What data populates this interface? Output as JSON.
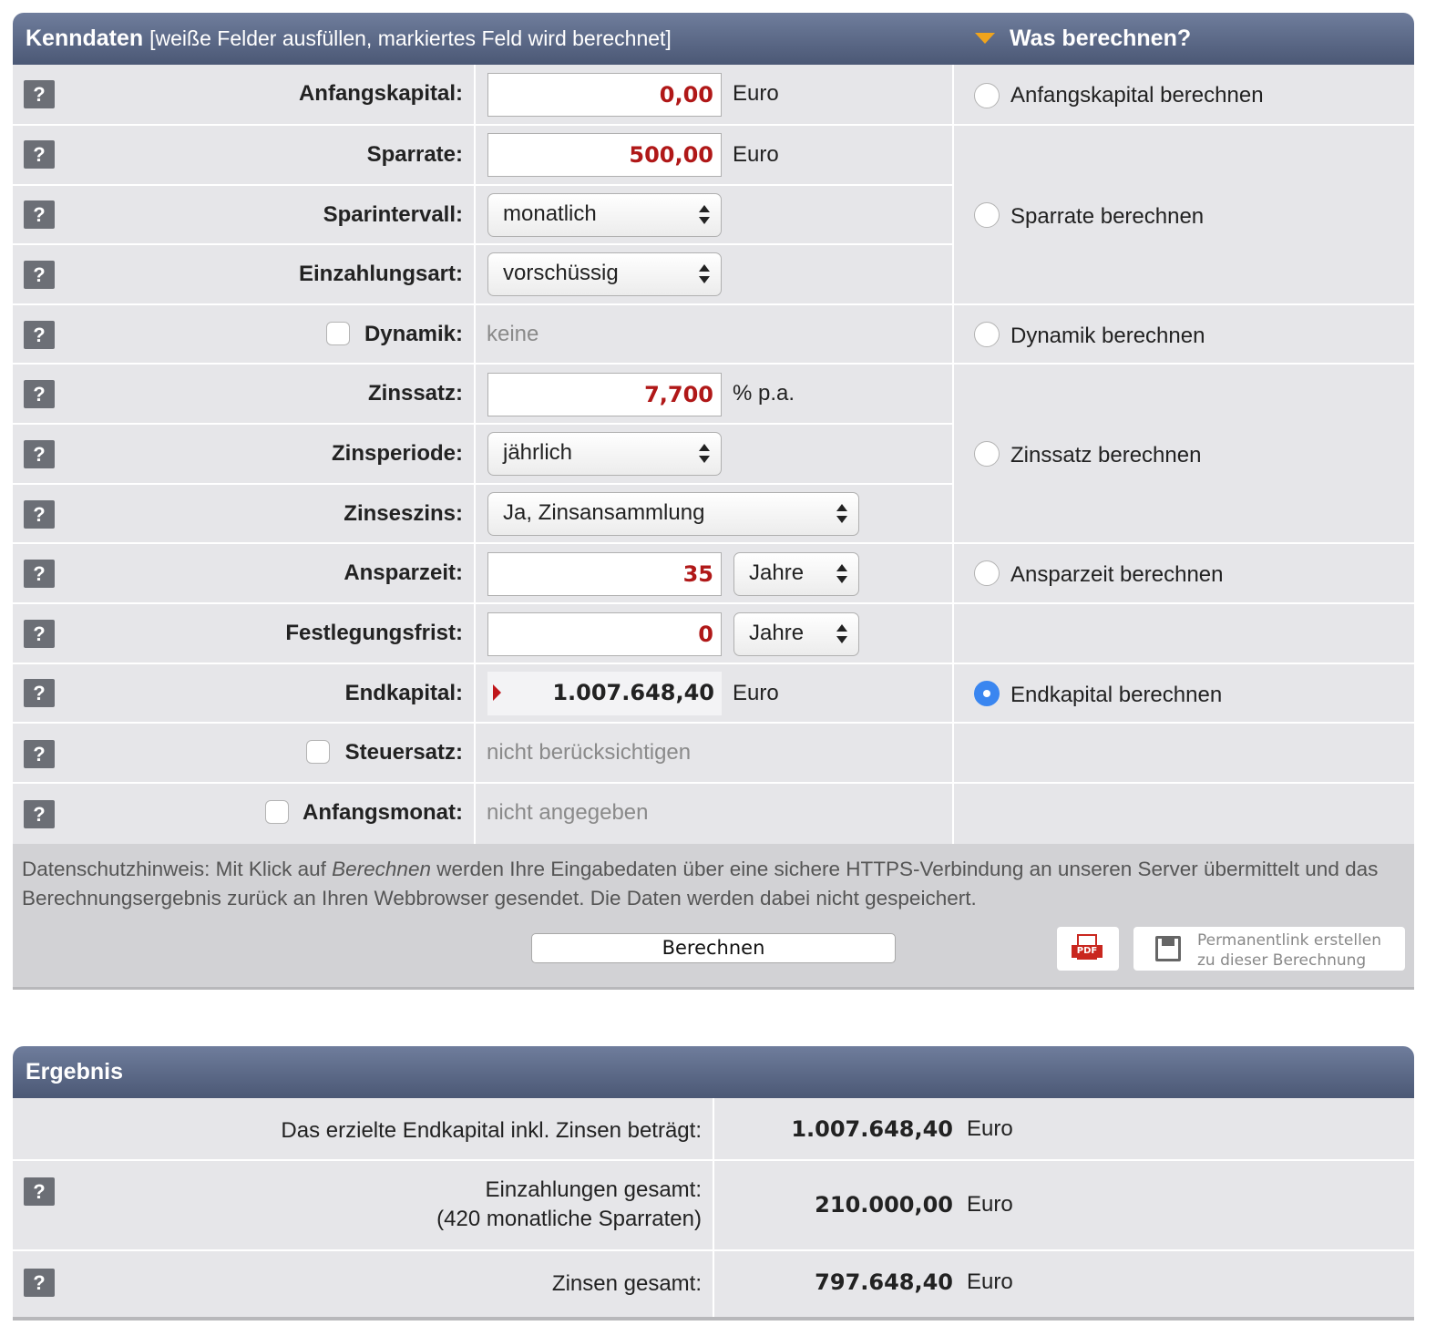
{
  "kenndaten": {
    "title": "Kenndaten",
    "subtitle": "[weiße Felder ausfüllen, markiertes Feld wird berechnet]",
    "was_title": "Was berechnen?",
    "help": "?",
    "rows": {
      "anfangskapital": {
        "label": "Anfangskapital:",
        "value": "0,00",
        "unit": "Euro"
      },
      "sparrate": {
        "label": "Sparrate:",
        "value": "500,00",
        "unit": "Euro"
      },
      "sparintervall": {
        "label": "Sparintervall:",
        "value": "monatlich"
      },
      "einzahlungsart": {
        "label": "Einzahlungsart:",
        "value": "vorschüssig"
      },
      "dynamik": {
        "label": "Dynamik:",
        "value": "keine"
      },
      "zinssatz": {
        "label": "Zinssatz:",
        "value": "7,700",
        "unit": "% p.a."
      },
      "zinsperiode": {
        "label": "Zinsperiode:",
        "value": "jährlich"
      },
      "zinseszins": {
        "label": "Zinseszins:",
        "value": "Ja, Zinsansammlung"
      },
      "ansparzeit": {
        "label": "Ansparzeit:",
        "value": "35",
        "unit": "Jahre"
      },
      "festlegungsfrist": {
        "label": "Festlegungsfrist:",
        "value": "0",
        "unit": "Jahre"
      },
      "endkapital": {
        "label": "Endkapital:",
        "value": "1.007.648,40",
        "unit": "Euro"
      },
      "steuersatz": {
        "label": "Steuersatz:",
        "value": "nicht berücksichtigen"
      },
      "anfangsmonat": {
        "label": "Anfangsmonat:",
        "value": "nicht angegeben"
      }
    },
    "options": {
      "anfangskapital": "Anfangskapital berechnen",
      "sparrate": "Sparrate berechnen",
      "dynamik": "Dynamik berechnen",
      "zinssatz": "Zinssatz berechnen",
      "ansparzeit": "Ansparzeit berechnen",
      "endkapital": "Endkapital berechnen",
      "selected": "endkapital"
    },
    "datenschutz": {
      "prefix": "Datenschutzhinweis: Mit Klick auf ",
      "emph": "Berechnen",
      "suffix": " werden Ihre Eingabedaten über eine sichere HTTPS-Verbindung an unseren Server übermittelt und das Berechnungsergebnis zurück an Ihren Webbrowser gesendet. Die Daten werden dabei nicht gespeichert."
    },
    "buttons": {
      "berechnen": "Berechnen",
      "pdf": "PDF",
      "permalink_line1": "Permanentlink erstellen",
      "permalink_line2": "zu dieser Berechnung"
    }
  },
  "ergebnis": {
    "title": "Ergebnis",
    "rows": [
      {
        "label": "Das erzielte Endkapital inkl. Zinsen beträgt:",
        "value": "1.007.648,40",
        "unit": "Euro"
      },
      {
        "label": "Einzahlungen gesamt:",
        "label2": "(420 monatliche Sparraten)",
        "value": "210.000,00",
        "unit": "Euro"
      },
      {
        "label": "Zinsen gesamt:",
        "value": "797.648,40",
        "unit": "Euro"
      }
    ]
  },
  "colors": {
    "header": "#4b5875",
    "accent_red": "#b01818",
    "radio_selected": "#3a86f0",
    "arrow": "#f0a41c"
  }
}
